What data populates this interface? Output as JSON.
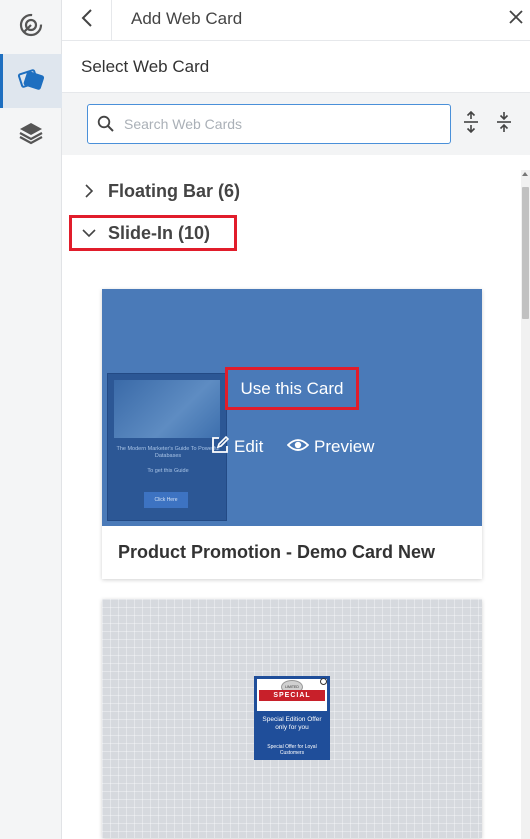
{
  "rail": {
    "items": [
      {
        "icon": "target-refresh-icon",
        "active": false
      },
      {
        "icon": "web-card-icon",
        "active": true
      },
      {
        "icon": "layers-icon",
        "active": false
      }
    ]
  },
  "header": {
    "title": "Add Web Card"
  },
  "section": {
    "title": "Select Web Card"
  },
  "search": {
    "placeholder": "Search Web Cards",
    "value": ""
  },
  "groups": [
    {
      "label": "Floating Bar (6)",
      "expanded": false
    },
    {
      "label": "Slide-In (10)",
      "expanded": true
    }
  ],
  "cards": [
    {
      "title": "Product Promotion - Demo Card New",
      "hover_actions": {
        "use": "Use this Card",
        "edit": "Edit",
        "preview": "Preview"
      },
      "mini_preview": {
        "line1": "The Modern Marketer's Guide To Powerful Databases",
        "line2": "To get this Guide",
        "button": "Click Here"
      }
    },
    {
      "title": "",
      "mini_preview": {
        "ribbon": "SPECIAL",
        "badge": "LIMITED EDITION",
        "line1": "Special Edition Offer only for you",
        "line2": "Special Offer for Loyal Customers"
      }
    }
  ],
  "colors": {
    "accent": "#1e6fc0",
    "highlight": "#e11d2b",
    "card_blue": "#4a7ab8"
  }
}
